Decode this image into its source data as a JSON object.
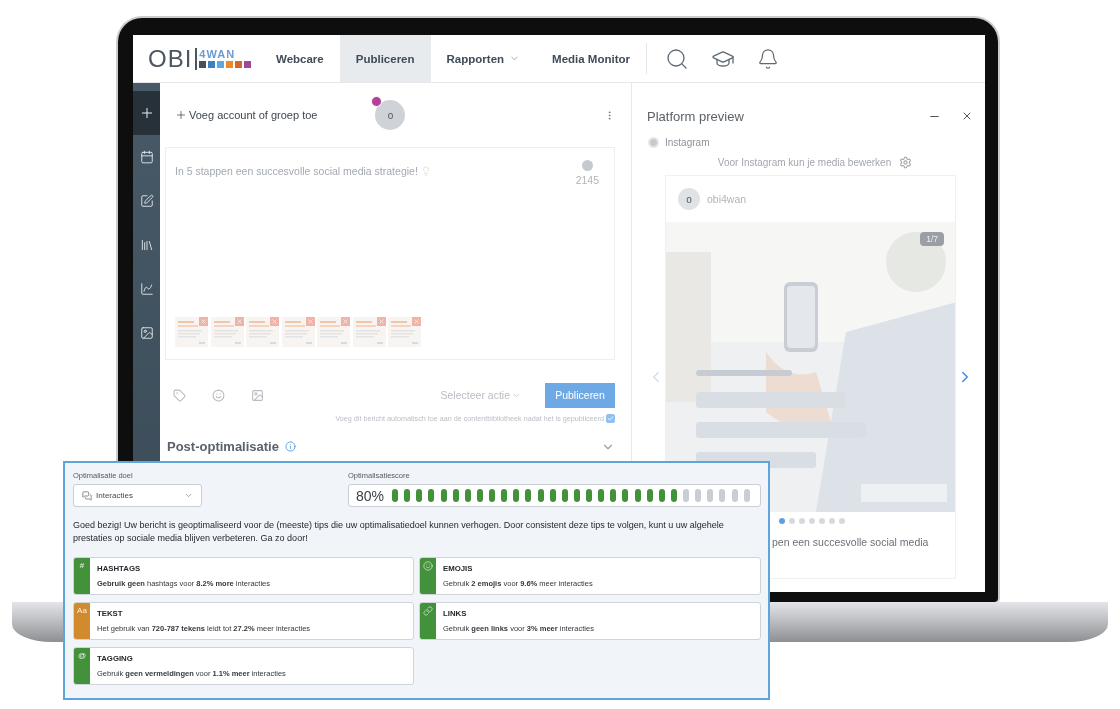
{
  "nav": {
    "logo": {
      "left": "OBI",
      "right": "4WAN"
    },
    "tabs": [
      {
        "label": "Webcare",
        "selected": false,
        "has_menu": false
      },
      {
        "label": "Publiceren",
        "selected": true,
        "has_menu": false
      },
      {
        "label": "Rapporten",
        "selected": false,
        "has_menu": true
      },
      {
        "label": "Media Monitor",
        "selected": false,
        "has_menu": false
      }
    ]
  },
  "sidebar": {
    "items": [
      {
        "selected": true
      },
      {
        "selected": false
      },
      {
        "selected": false
      },
      {
        "selected": false
      },
      {
        "selected": false
      },
      {
        "selected": false
      }
    ]
  },
  "composer": {
    "add_account": "Voeg account of groep toe",
    "avatar_letter": "o",
    "message": "In 5 stappen een succesvolle social media strategie!",
    "counter": "2145",
    "action_select": "Selecteer actie",
    "publish_button": {
      "label": "Publiceren",
      "disabled": true
    },
    "library_option": {
      "label": "Voeg dit bericht automatisch toe aan de contentbibliotheek nadat het is gepubliceerd",
      "checked": true
    },
    "section": {
      "title": "Post-optimalisatie",
      "expanded": false
    }
  },
  "preview": {
    "title": "Platform preview",
    "platform": {
      "label": "Instagram",
      "selected": false
    },
    "note": "Voor Instagram kun je media bewerken",
    "post": {
      "avatar_letter": "o",
      "account": "obi4wan",
      "counter": "1/7",
      "slides": [
        {
          "selected": true
        },
        {
          "selected": false
        },
        {
          "selected": false
        },
        {
          "selected": false
        },
        {
          "selected": false
        },
        {
          "selected": false
        },
        {
          "selected": false
        }
      ],
      "caption": "pen een succesvolle social media"
    }
  },
  "optimization": {
    "goal_label": "Optimalisatie doel",
    "goal_value": "Interacties",
    "score_label": "Optimalisatiescore",
    "score": "80%",
    "level": 0.8,
    "message": "Goed bezig! Uw bericht is geoptimaliseerd voor de (meeste) tips die uw optimalisatiedoel kunnen verhogen. Door consistent deze tips te volgen, kunt u uw algehele prestaties op sociale media blijven verbeteren. Ga zo door!",
    "tips": [
      {
        "kind": "symbol",
        "symbol": "#",
        "title": "HASHTAGS",
        "text": "**Gebruik geen** hashtags voor **8.2% more** interacties",
        "color": "#43913a"
      },
      {
        "kind": "smiley",
        "title": "EMOJIS",
        "text": "Gebruik **2 emojis** voor **9.6%** meer interacties",
        "color": "#43913a"
      },
      {
        "kind": "symbol",
        "symbol": "Aa",
        "title": "TEKST",
        "text": "Het gebruik van **720-787 tekens** leidt tot **27.2%** meer interacties",
        "color": "#d18a2e"
      },
      {
        "kind": "link",
        "title": "LINKS",
        "text": "Gebruik **geen links** voor **3% meer** interacties",
        "color": "#43913a"
      },
      {
        "kind": "symbol",
        "symbol": "@",
        "title": "TAGGING",
        "text": "Gebruik **geen vermeldingen** voor **1.1% meer** interacties",
        "color": "#43913a"
      }
    ]
  }
}
